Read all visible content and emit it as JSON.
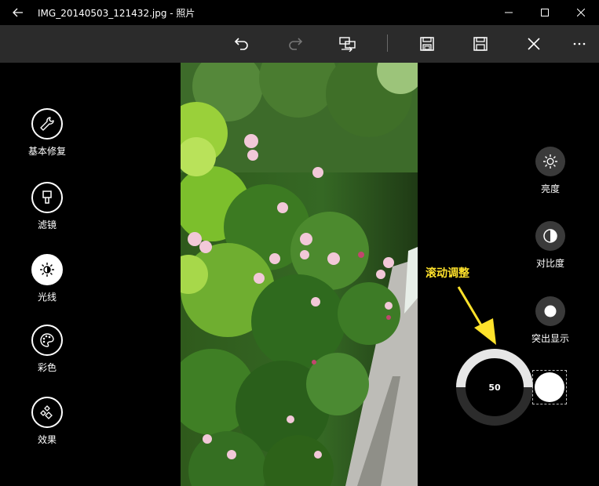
{
  "window": {
    "title": "IMG_20140503_121432.jpg - 照片"
  },
  "toolbar": {
    "icons": [
      "undo-icon",
      "redo-icon",
      "compare-icon",
      "save-copy-icon",
      "save-icon",
      "close-icon",
      "more-icon"
    ]
  },
  "left_menu": {
    "items": [
      {
        "label": "基本修复",
        "icon": "wrench-icon",
        "active": false
      },
      {
        "label": "滤镜",
        "icon": "brush-icon",
        "active": false
      },
      {
        "label": "光线",
        "icon": "sun-icon",
        "active": true
      },
      {
        "label": "彩色",
        "icon": "palette-icon",
        "active": false
      },
      {
        "label": "效果",
        "icon": "effects-icon",
        "active": false
      }
    ]
  },
  "right_menu": {
    "items": [
      {
        "label": "亮度",
        "icon": "sun-icon"
      },
      {
        "label": "对比度",
        "icon": "contrast-icon"
      },
      {
        "label": "突出显示",
        "icon": "highlight-icon"
      }
    ]
  },
  "annotation": {
    "text": "滚动调整",
    "color": "#ffe22b"
  },
  "dial": {
    "value": "50",
    "level": 0.5
  },
  "colors": {
    "toolbar_bg": "#2b2b2b",
    "annotation": "#ffe22b"
  }
}
